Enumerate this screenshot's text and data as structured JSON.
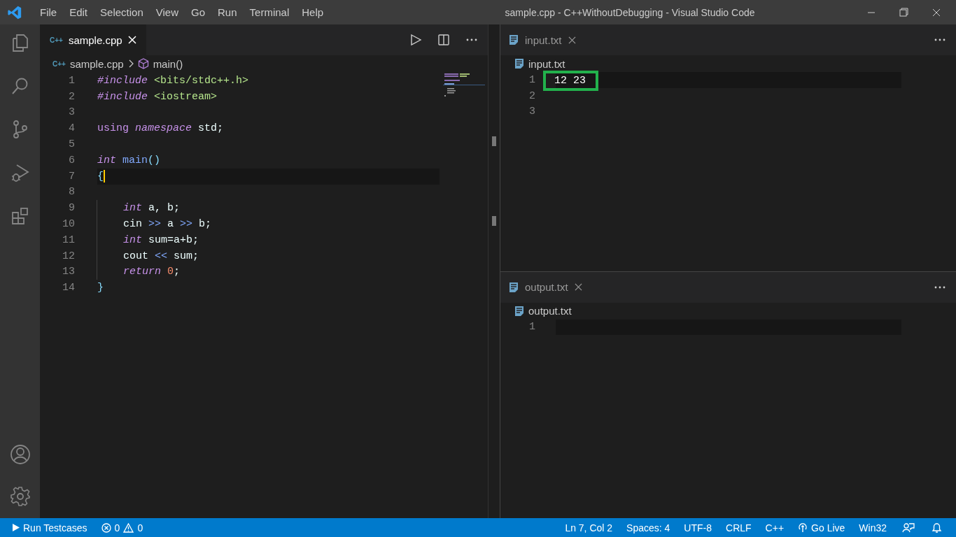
{
  "window": {
    "title": "sample.cpp - C++WithoutDebugging - Visual Studio Code"
  },
  "menu": [
    "File",
    "Edit",
    "Selection",
    "View",
    "Go",
    "Run",
    "Terminal",
    "Help"
  ],
  "editor": {
    "tab": {
      "icon_label": "C++",
      "label": "sample.cpp"
    },
    "breadcrumb": [
      {
        "kind": "file",
        "icon_label": "C++",
        "label": "sample.cpp"
      },
      {
        "kind": "symbol",
        "label": "main()"
      }
    ],
    "lines": [
      {
        "number": "1",
        "tokens": [
          {
            "kind": "directive",
            "text": "#include "
          },
          {
            "kind": "header",
            "text": "<bits/stdc++.h>"
          }
        ]
      },
      {
        "number": "2",
        "tokens": [
          {
            "kind": "directive",
            "text": "#include "
          },
          {
            "kind": "header",
            "text": "<iostream>"
          }
        ]
      },
      {
        "number": "3"
      },
      {
        "number": "4",
        "tokens": [
          {
            "kind": "keyword",
            "text": "using "
          },
          {
            "kind": "type",
            "text": "namespace"
          },
          {
            "kind": "plain",
            "text": " std;"
          }
        ]
      },
      {
        "number": "5"
      },
      {
        "number": "6",
        "tokens": [
          {
            "kind": "type",
            "text": "int "
          },
          {
            "kind": "function",
            "text": "main"
          },
          {
            "kind": "punct",
            "text": "()"
          }
        ]
      },
      {
        "number": "7",
        "current": true,
        "tokens": [
          {
            "kind": "punct",
            "text": "{"
          }
        ]
      },
      {
        "number": "8"
      },
      {
        "number": "9",
        "indented": true,
        "tokens": [
          {
            "kind": "type",
            "text": "int"
          },
          {
            "kind": "plain",
            "text": " a, b;"
          }
        ]
      },
      {
        "number": "10",
        "indented": true,
        "tokens": [
          {
            "kind": "plain",
            "text": "cin "
          },
          {
            "kind": "operator",
            "text": ">>"
          },
          {
            "kind": "plain",
            "text": " a "
          },
          {
            "kind": "operator",
            "text": ">>"
          },
          {
            "kind": "plain",
            "text": " b;"
          }
        ]
      },
      {
        "number": "11",
        "indented": true,
        "tokens": [
          {
            "kind": "type",
            "text": "int"
          },
          {
            "kind": "plain",
            "text": " sum=a+b;"
          }
        ]
      },
      {
        "number": "12",
        "indented": true,
        "tokens": [
          {
            "kind": "plain",
            "text": "cout "
          },
          {
            "kind": "operator",
            "text": "<<"
          },
          {
            "kind": "plain",
            "text": " sum;"
          }
        ]
      },
      {
        "number": "13",
        "indented": true,
        "tokens": [
          {
            "kind": "type",
            "text": "return "
          },
          {
            "kind": "number",
            "text": "0"
          },
          {
            "kind": "plain",
            "text": ";"
          }
        ]
      },
      {
        "number": "14",
        "tokens": [
          {
            "kind": "punct",
            "text": "}"
          }
        ]
      }
    ]
  },
  "panes": [
    {
      "tab": "input.txt",
      "breadcrumb": "input.txt",
      "lines": [
        {
          "number": "1",
          "text": "12 23",
          "current": true,
          "boxed": true
        },
        {
          "number": "2"
        },
        {
          "number": "3"
        }
      ]
    },
    {
      "tab": "output.txt",
      "breadcrumb": "output.txt",
      "lines": [
        {
          "number": "1",
          "current": true
        }
      ]
    }
  ],
  "status_bar": {
    "left": [
      {
        "kind": "run",
        "label": "Run Testcases"
      },
      {
        "kind": "problems",
        "errors": "0",
        "warnings": "0"
      }
    ],
    "right": [
      {
        "kind": "text",
        "label": "Ln 7, Col 2"
      },
      {
        "kind": "text",
        "label": "Spaces: 4"
      },
      {
        "kind": "text",
        "label": "UTF-8"
      },
      {
        "kind": "text",
        "label": "CRLF"
      },
      {
        "kind": "text",
        "label": "C++"
      },
      {
        "kind": "live",
        "label": "Go Live"
      },
      {
        "kind": "text",
        "label": "Win32"
      },
      {
        "kind": "feedback"
      },
      {
        "kind": "bell"
      }
    ]
  }
}
